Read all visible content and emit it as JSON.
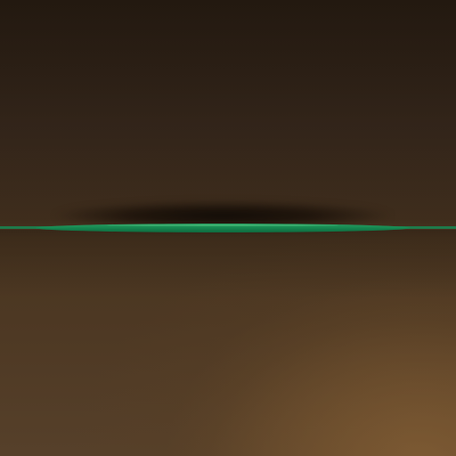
{
  "scene": {
    "colors": {
      "background_dark": "#2b1f14",
      "background_light": "#56402a",
      "line_green": "#1e7a4a",
      "shadow": "#140c06"
    }
  }
}
